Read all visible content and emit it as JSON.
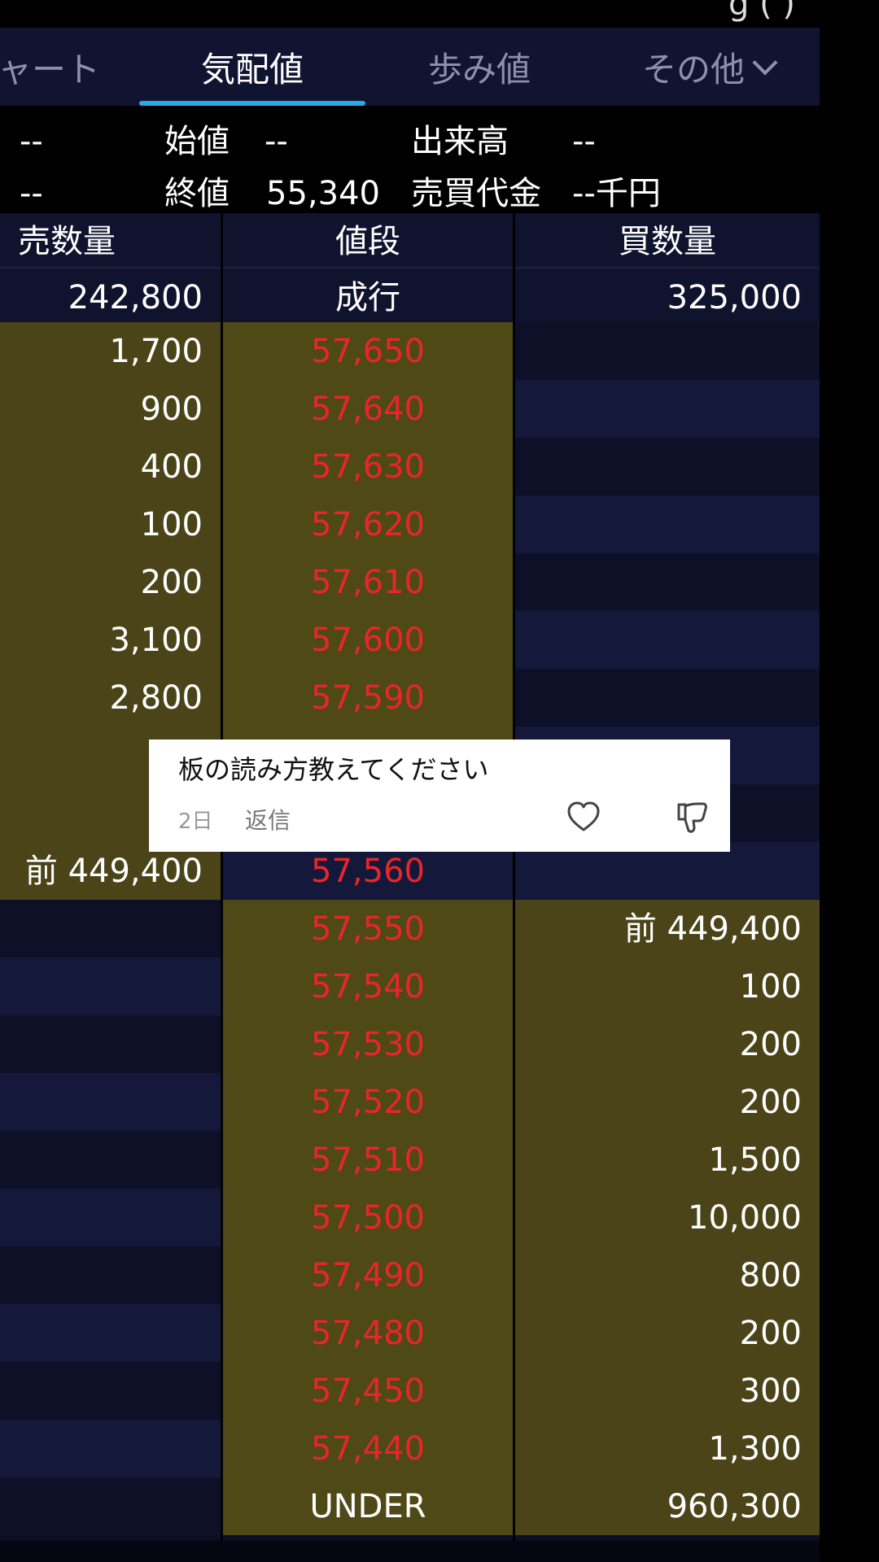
{
  "topbar": {
    "text": "g      (    )"
  },
  "tabs": [
    {
      "label": "ャート"
    },
    {
      "label": "気配値"
    },
    {
      "label": "歩み値"
    },
    {
      "label": "その他"
    }
  ],
  "summary": {
    "left_top": "--",
    "left_bottom": "--",
    "open_label": "始値",
    "open_value": "--",
    "close_label": "終値",
    "close_value": "55,340",
    "volume_label": "出来高",
    "volume_value": "--",
    "turnover_label": "売買代金",
    "turnover_value": "--千円"
  },
  "columns": {
    "sell_qty": "売数量",
    "price": "値段",
    "buy_qty": "買数量"
  },
  "market_order": {
    "sell_qty": "242,800",
    "label": "成行",
    "buy_qty": "325,000"
  },
  "book": [
    {
      "sell": "1,700",
      "price": "57,650",
      "buy": ""
    },
    {
      "sell": "900",
      "price": "57,640",
      "buy": ""
    },
    {
      "sell": "400",
      "price": "57,630",
      "buy": ""
    },
    {
      "sell": "100",
      "price": "57,620",
      "buy": ""
    },
    {
      "sell": "200",
      "price": "57,610",
      "buy": ""
    },
    {
      "sell": "3,100",
      "price": "57,600",
      "buy": ""
    },
    {
      "sell": "2,800",
      "price": "57,590",
      "buy": ""
    },
    {
      "sell": "1,4",
      "price": "",
      "buy": ""
    },
    {
      "sell": "1,0",
      "price": "",
      "buy": ""
    },
    {
      "sell": "前 449,400",
      "price": "57,560",
      "buy": ""
    },
    {
      "sell": "",
      "price": "57,550",
      "buy": "前 449,400"
    },
    {
      "sell": "",
      "price": "57,540",
      "buy": "100"
    },
    {
      "sell": "",
      "price": "57,530",
      "buy": "200"
    },
    {
      "sell": "",
      "price": "57,520",
      "buy": "200"
    },
    {
      "sell": "",
      "price": "57,510",
      "buy": "1,500"
    },
    {
      "sell": "",
      "price": "57,500",
      "buy": "10,000"
    },
    {
      "sell": "",
      "price": "57,490",
      "buy": "800"
    },
    {
      "sell": "",
      "price": "57,480",
      "buy": "200"
    },
    {
      "sell": "",
      "price": "57,450",
      "buy": "300"
    },
    {
      "sell": "",
      "price": "57,440",
      "buy": "1,300"
    },
    {
      "sell": "",
      "price": "UNDER",
      "buy": "960,300"
    }
  ],
  "comment": {
    "text": "板の読み方教えてください",
    "time": "2日",
    "reply": "返信",
    "like_icon": "heart-icon",
    "dislike_icon": "thumbs-down-icon"
  },
  "colors": {
    "background": "#0c0f24",
    "highlight": "#4a4418",
    "price_text": "#e8262a",
    "tab_indicator": "#29a8e8"
  }
}
